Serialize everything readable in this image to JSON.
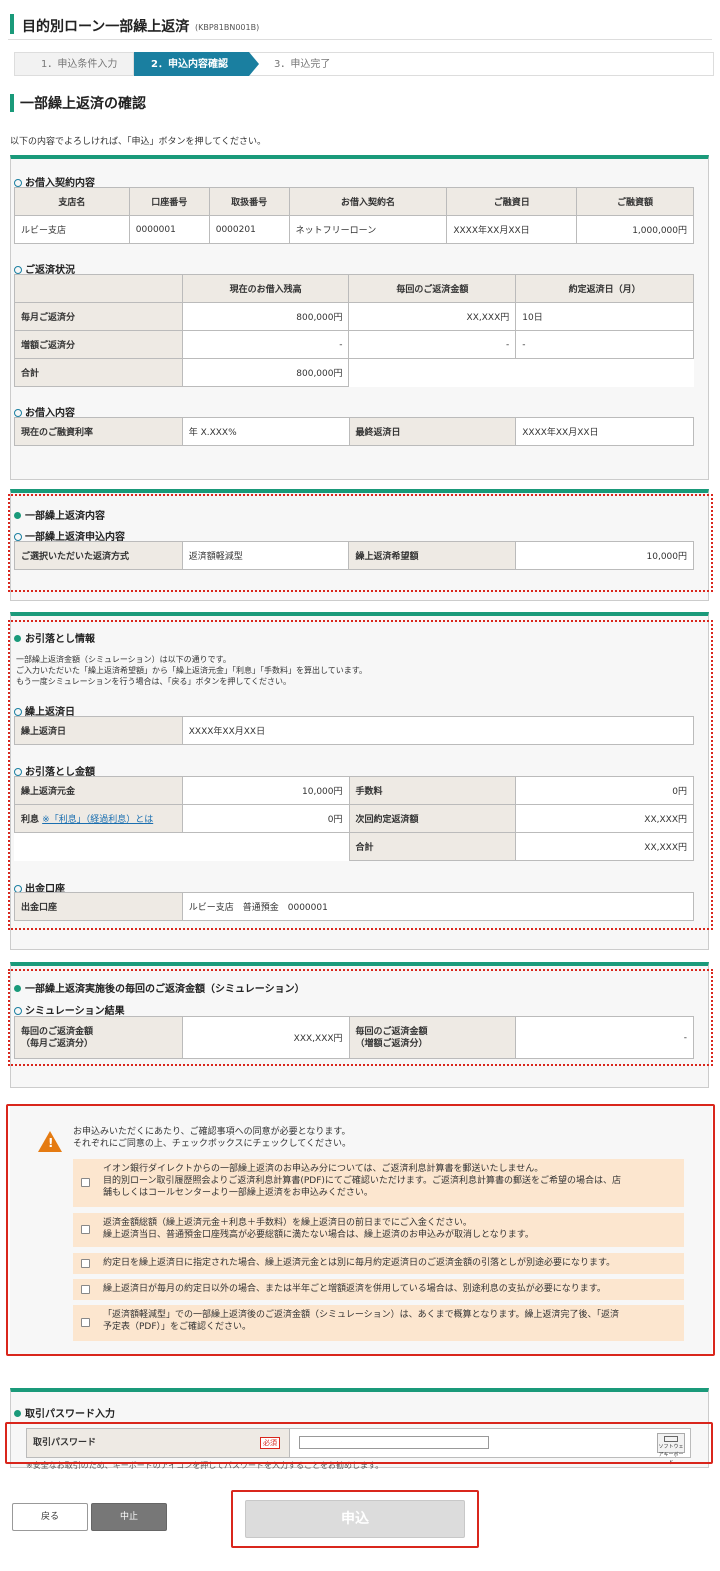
{
  "header": {
    "title": "目的別ローン一部繰上返済",
    "code": "(KBP81BN001B)"
  },
  "steps": [
    "1．申込条件入力",
    "2．申込内容確認",
    "3．申込完了"
  ],
  "section_title": "一部繰上返済の確認",
  "intro": "以下の内容でよろしければ、「申込」ボタンを押してください。",
  "loan_contract": {
    "heading": "お借入契約内容",
    "headers": [
      "支店名",
      "口座番号",
      "取扱番号",
      "お借入契約名",
      "ご融資日",
      "ご融資額"
    ],
    "row": [
      "ルビー支店",
      "0000001",
      "0000201",
      "ネットフリーローン",
      "XXXX年XX月XX日",
      "1,000,000円"
    ]
  },
  "repayment_status": {
    "heading": "ご返済状況",
    "headers": [
      "",
      "現在のお借入残高",
      "毎回のご返済金額",
      "約定返済日（月）"
    ],
    "rows": [
      [
        "毎月ご返済分",
        "800,000円",
        "XX,XXX円",
        "10日"
      ],
      [
        "増額ご返済分",
        "-",
        "-",
        "-"
      ],
      [
        "合計",
        "800,000円"
      ]
    ]
  },
  "loan_details": {
    "heading": "お借入内容",
    "rate_label": "現在のご融資利率",
    "rate_value": "年 X.XXX%",
    "last_label": "最終返済日",
    "last_value": "XXXX年XX月XX日"
  },
  "prepay": {
    "heading": "一部繰上返済内容",
    "sub": "一部繰上返済申込内容",
    "method_label": "ご選択いただいた返済方式",
    "method_value": "返済額軽減型",
    "amount_label": "繰上返済希望額",
    "amount_value": "10,000円"
  },
  "debit": {
    "heading": "お引落とし情報",
    "note1": "一部繰上返済金額（シミュレーション）は以下の通りです。",
    "note2": "ご入力いただいた「繰上返済希望額」から「繰上返済元金」「利息」「手数料」を算出しています。",
    "note3": "もう一度シミュレーションを行う場合は、「戻る」ボタンを押してください。",
    "date_heading": "繰上返済日",
    "date_label": "繰上返済日",
    "date_value": "XXXX年XX月XX日",
    "amount_heading": "お引落とし金額",
    "principal_label": "繰上返済元金",
    "principal_value": "10,000円",
    "fee_label": "手数料",
    "fee_value": "0円",
    "interest_label": "利息",
    "interest_link": "※「利息」（経過利息）とは",
    "interest_value": "0円",
    "next_label": "次回約定返済額",
    "next_value": "XX,XXX円",
    "total_label": "合計",
    "total_value": "XX,XXX円",
    "account_heading": "出金口座",
    "account_label": "出金口座",
    "account_value": "ルビー支店　普通預金　0000001"
  },
  "simulation": {
    "heading": "一部繰上返済実施後の毎回のご返済金額（シミュレーション）",
    "sub": "シミュレーション結果",
    "monthly_label1": "毎回のご返済金額",
    "monthly_label2": "（毎月ご返済分）",
    "monthly_value": "XXX,XXX円",
    "bonus_label1": "毎回のご返済金額",
    "bonus_label2": "（増額ご返済分）",
    "bonus_value": "-"
  },
  "consent": {
    "lead1": "お申込みいただくにあたり、ご確認事項への同意が必要となります。",
    "lead2": "それぞれにご同意の上、チェックボックスにチェックしてください。",
    "items": [
      [
        "イオン銀行ダイレクトからの一部繰上返済のお申込み分については、ご返済利息計算書を郵送いたしません。",
        "目的別ローン取引履歴照会よりご返済利息計算書(PDF)にてご確認いただけます。ご返済利息計算書の郵送をご希望の場合は、店",
        "舗もしくはコールセンターより一部繰上返済をお申込みください。"
      ],
      [
        "返済金額総額（繰上返済元金＋利息＋手数料）を繰上返済日の前日までにご入金ください。",
        "繰上返済当日、普通預金口座残高が必要総額に満たない場合は、繰上返済のお申込みが取消しとなります。"
      ],
      [
        "約定日を繰上返済日に指定された場合、繰上返済元金とは別に毎月約定返済日のご返済金額の引落としが別途必要になります。"
      ],
      [
        "繰上返済日が毎月の約定日以外の場合、または半年ごと増額返済を併用している場合は、別途利息の支払が必要になります。"
      ],
      [
        "「返済額軽減型」での一部繰上返済後のご返済金額（シミュレーション）は、あくまで概算となります。繰上返済完了後、「返済",
        "予定表（PDF）」をご確認ください。"
      ]
    ]
  },
  "password": {
    "heading": "取引パスワード入力",
    "label": "取引パスワード",
    "required": "必須",
    "keyboard": "ソフトウェアキーボード",
    "note": "※安全なお取引のため、キーボードのアイコンを押してパスワードを入力することをお勧めします。"
  },
  "buttons": {
    "back": "戻る",
    "stop": "中止",
    "apply": "申込"
  },
  "colors": {
    "accent": "#1a9a7a",
    "step_active": "#1a7fa0",
    "alert": "#d9261c",
    "warning": "#e57b12",
    "consent_bg": "#fce6cf"
  }
}
